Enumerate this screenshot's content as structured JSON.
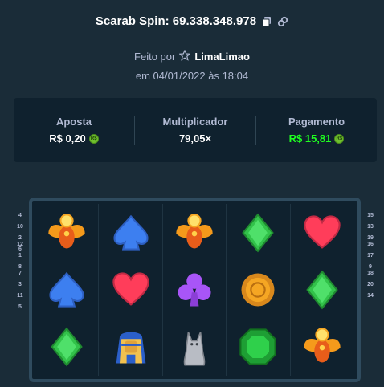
{
  "header": {
    "title": "Scarab Spin: 69.338.348.978",
    "copy_icon": "copy-icon",
    "link_icon": "link-icon"
  },
  "byline": {
    "prefix": "Feito por",
    "star_icon": "star-icon",
    "user": "LimaLimao",
    "date": "em 04/01/2022 às 18:04"
  },
  "stats": {
    "bet_label": "Aposta",
    "bet_value": "R$ 0,20",
    "multiplier_label": "Multiplicador",
    "multiplier_value": "79,05×",
    "payout_label": "Pagamento",
    "payout_value": "R$ 15,81",
    "currency_badge": "R$",
    "payout_color": "#1fff20"
  },
  "reels": {
    "grid": [
      [
        "scarab",
        "spade",
        "scarab",
        "diamond",
        "heart"
      ],
      [
        "spade",
        "heart",
        "club",
        "coin",
        "diamond"
      ],
      [
        "diamond",
        "pharaoh",
        "cat",
        "emerald",
        "scarab"
      ]
    ]
  },
  "paylines": {
    "left": [
      [
        "4",
        "10",
        "2",
        "6"
      ],
      [
        "12",
        "1",
        "8"
      ],
      [
        "7",
        "3",
        "11",
        "5"
      ]
    ],
    "right": [
      [
        "15",
        "13",
        "19"
      ],
      [
        "16",
        "17",
        "9"
      ],
      [
        "18",
        "20",
        "14"
      ]
    ]
  }
}
